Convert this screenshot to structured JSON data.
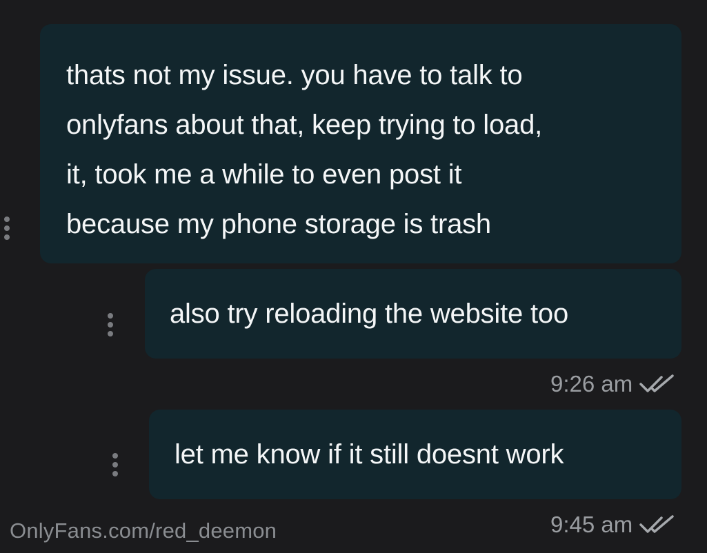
{
  "messages": [
    {
      "text": "thats not my issue. you have to talk to\nonlyfans about that, keep trying to load,\nit, took me a while to even post it\nbecause my phone storage is trash"
    },
    {
      "text": "also try reloading the website too"
    },
    {
      "text": "let me know if it still doesnt work"
    }
  ],
  "timestamps": {
    "first_group": "9:26 am",
    "second_group": "9:45 am"
  },
  "status_icon": "double-check-icon",
  "watermark": "OnlyFans.com/red_deemon",
  "colors": {
    "background": "#1b1b1d",
    "bubble": "#12262d",
    "text": "#f4f6f7",
    "meta": "#9a9da1"
  }
}
